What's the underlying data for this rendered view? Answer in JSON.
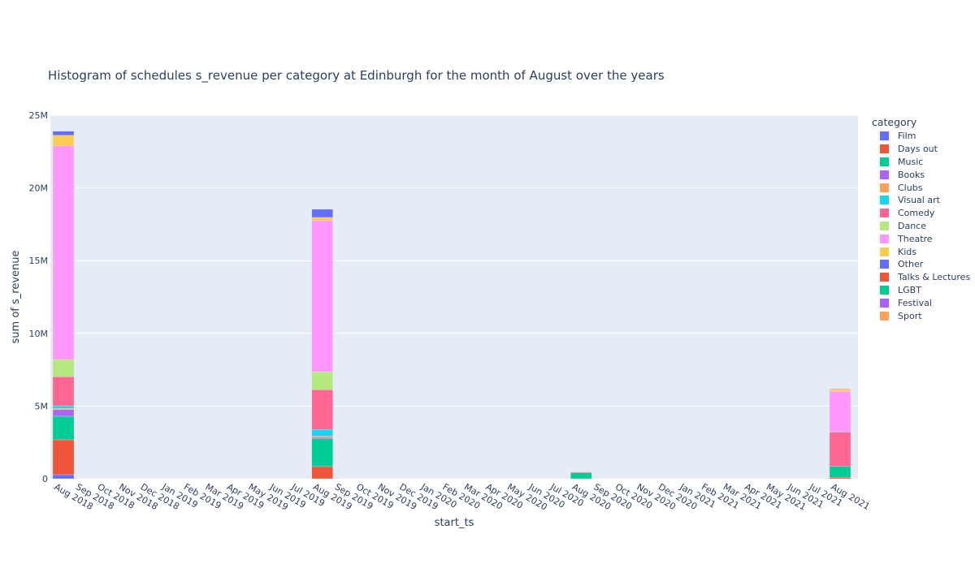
{
  "chart_data": {
    "type": "bar",
    "barmode": "stack",
    "title": "Histogram of schedules s_revenue per category at Edinburgh for the month of August over the years",
    "xlabel": "start_ts",
    "ylabel": "sum of s_revenue",
    "ylim": [
      0,
      25000000
    ],
    "yticks": [
      0,
      5000000,
      10000000,
      15000000,
      20000000,
      25000000
    ],
    "ytick_labels": [
      "0",
      "5M",
      "10M",
      "15M",
      "20M",
      "25M"
    ],
    "grid": true,
    "legend_title": "category",
    "legend_position": "right",
    "x_tick_labels": [
      "Aug 2018",
      "Sep 2018",
      "Oct 2018",
      "Nov 2018",
      "Dec 2018",
      "Jan 2019",
      "Feb 2019",
      "Mar 2019",
      "Apr 2019",
      "May 2019",
      "Jun 2019",
      "Jul 2019",
      "Aug 2019",
      "Sep 2019",
      "Oct 2019",
      "Nov 2019",
      "Dec 2019",
      "Jan 2020",
      "Feb 2020",
      "Mar 2020",
      "Apr 2020",
      "May 2020",
      "Jun 2020",
      "Jul 2020",
      "Aug 2020",
      "Sep 2020",
      "Oct 2020",
      "Nov 2020",
      "Dec 2020",
      "Jan 2021",
      "Feb 2021",
      "Mar 2021",
      "Apr 2021",
      "May 2021",
      "Jun 2021",
      "Jul 2021",
      "Aug 2021"
    ],
    "categories": [
      "Aug 2018",
      "Aug 2019",
      "Aug 2020",
      "Aug 2021"
    ],
    "category_month_index": [
      0,
      12,
      24,
      36
    ],
    "series": [
      {
        "name": "Film",
        "color": "#636efa",
        "values": [
          280000,
          0,
          0,
          0
        ]
      },
      {
        "name": "Days out",
        "color": "#EF553B",
        "values": [
          2400000,
          840000,
          0,
          100000
        ]
      },
      {
        "name": "Music",
        "color": "#00cc96",
        "values": [
          1620000,
          1900000,
          400000,
          750000
        ]
      },
      {
        "name": "Books",
        "color": "#ab63fa",
        "values": [
          450000,
          100000,
          0,
          0
        ]
      },
      {
        "name": "Clubs",
        "color": "#FFA15A",
        "values": [
          100000,
          100000,
          0,
          0
        ]
      },
      {
        "name": "Visual art",
        "color": "#19d3f3",
        "values": [
          170000,
          450000,
          0,
          0
        ]
      },
      {
        "name": "Comedy",
        "color": "#FF6692",
        "values": [
          2000000,
          2730000,
          60000,
          2350000
        ]
      },
      {
        "name": "Dance",
        "color": "#B6E880",
        "values": [
          1170000,
          1230000,
          0,
          0
        ]
      },
      {
        "name": "Theatre",
        "color": "#FF97FF",
        "values": [
          14700000,
          10400000,
          0,
          2800000
        ]
      },
      {
        "name": "Kids",
        "color": "#FECB52",
        "values": [
          730000,
          220000,
          0,
          120000
        ]
      },
      {
        "name": "Other",
        "color": "#636efa",
        "values": [
          280000,
          560000,
          0,
          0
        ]
      },
      {
        "name": "Talks & Lectures",
        "color": "#EF553B",
        "values": [
          0,
          0,
          0,
          0
        ]
      },
      {
        "name": "LGBT",
        "color": "#00cc96",
        "values": [
          0,
          0,
          0,
          0
        ]
      },
      {
        "name": "Festival",
        "color": "#ab63fa",
        "values": [
          0,
          0,
          0,
          0
        ]
      },
      {
        "name": "Sport",
        "color": "#FFA15A",
        "values": [
          0,
          0,
          0,
          60000
        ]
      }
    ]
  }
}
